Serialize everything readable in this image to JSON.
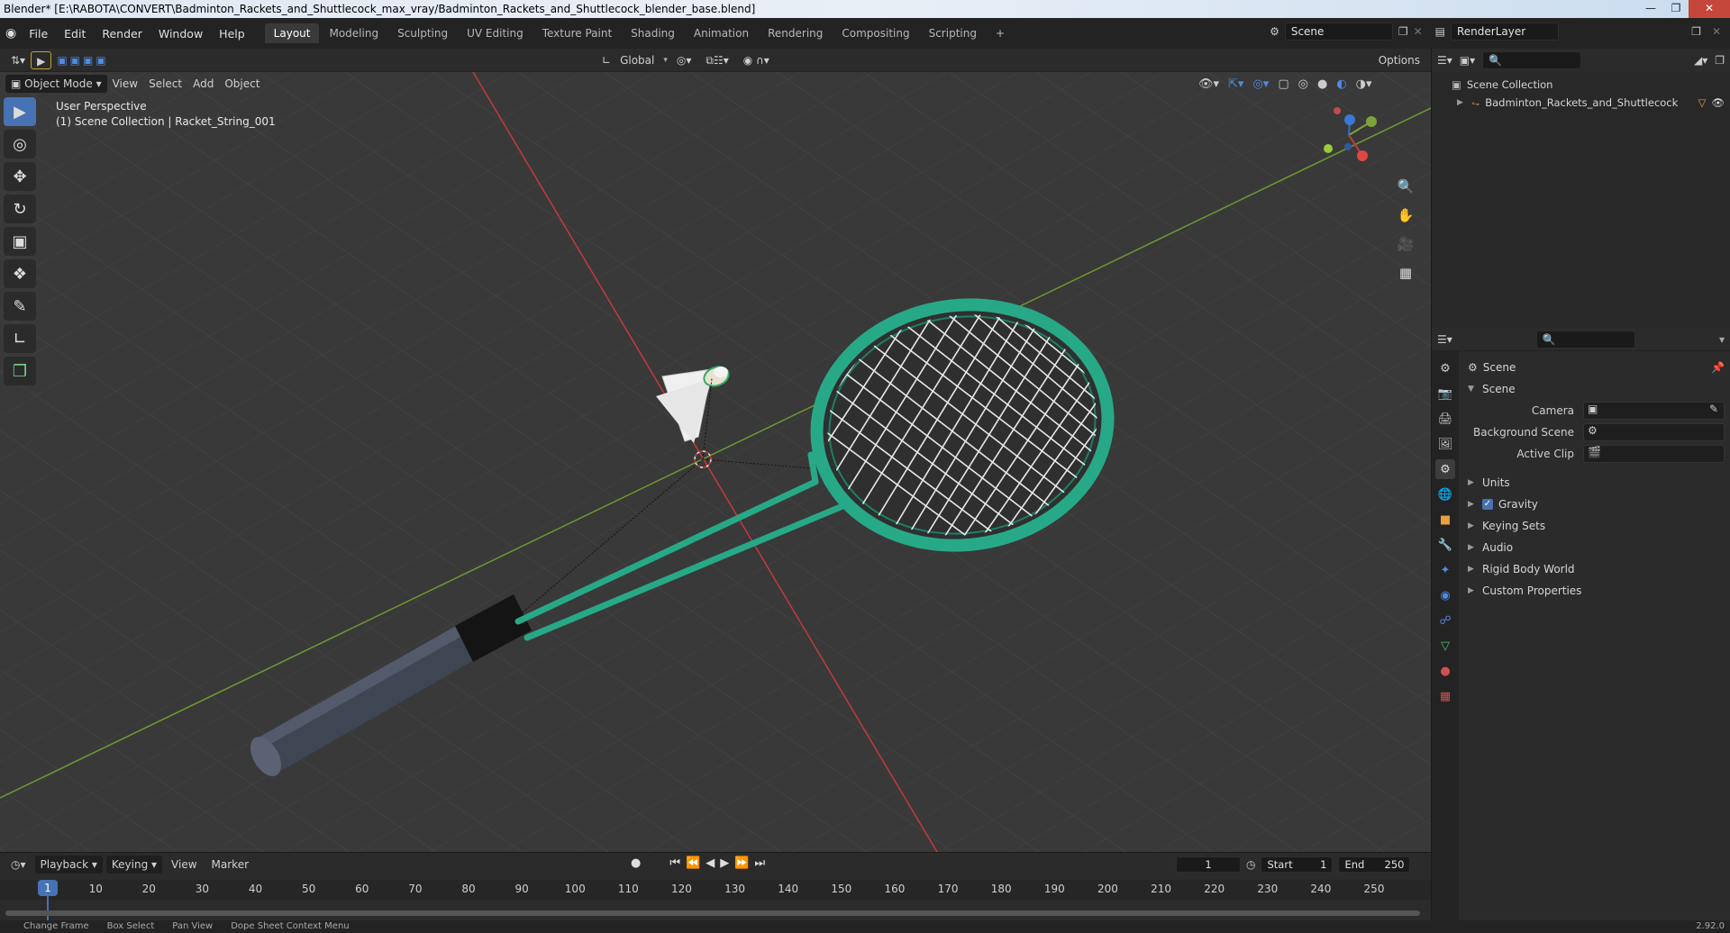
{
  "title": "Blender* [E:\\RABOTA\\CONVERT\\Badminton_Rackets_and_Shuttlecock_max_vray/Badminton_Rackets_and_Shuttlecock_blender_base.blend]",
  "menu": [
    "File",
    "Edit",
    "Render",
    "Window",
    "Help"
  ],
  "workspaces": [
    {
      "label": "Layout",
      "active": true
    },
    {
      "label": "Modeling"
    },
    {
      "label": "Sculpting"
    },
    {
      "label": "UV Editing"
    },
    {
      "label": "Texture Paint"
    },
    {
      "label": "Shading"
    },
    {
      "label": "Animation"
    },
    {
      "label": "Rendering"
    },
    {
      "label": "Compositing"
    },
    {
      "label": "Scripting"
    }
  ],
  "plus": "+",
  "scene_name": "Scene",
  "render_layer": "RenderLayer",
  "header": {
    "transform_orientation": "Global",
    "options": "Options",
    "mode": "Object Mode",
    "view": "View",
    "select": "Select",
    "add": "Add",
    "object": "Object"
  },
  "viewport": {
    "perspective": "User Perspective",
    "context": "(1) Scene Collection | Racket_String_001"
  },
  "outliner": {
    "collection": "Scene Collection",
    "item": "Badminton_Rackets_and_Shuttlecock"
  },
  "properties": {
    "context_label": "Scene",
    "panel": "Scene",
    "camera_label": "Camera",
    "background_label": "Background Scene",
    "clip_label": "Active Clip",
    "sections": [
      "Units",
      "Gravity",
      "Keying Sets",
      "Audio",
      "Rigid Body World",
      "Custom Properties"
    ],
    "gravity_checked": true
  },
  "timeline": {
    "playback": "Playback",
    "keying": "Keying",
    "view": "View",
    "marker": "Marker",
    "current_frame": "1",
    "start_label": "Start",
    "start": "1",
    "end_label": "End",
    "end": "250",
    "ruler": [
      "1",
      "10",
      "20",
      "30",
      "40",
      "50",
      "60",
      "70",
      "80",
      "90",
      "100",
      "110",
      "120",
      "130",
      "140",
      "150",
      "160",
      "170",
      "180",
      "190",
      "200",
      "210",
      "220",
      "230",
      "240",
      "250"
    ]
  },
  "status": {
    "change_frame": "Change Frame",
    "box_select": "Box Select",
    "pan_view": "Pan View",
    "context_menu": "Dope Sheet Context Menu",
    "version": "2.92.0"
  },
  "colors": {
    "active_blue": "#4772b3",
    "racket_green": "#27a987",
    "x_axis": "#c43a3a",
    "y_axis": "#7aa33a"
  }
}
